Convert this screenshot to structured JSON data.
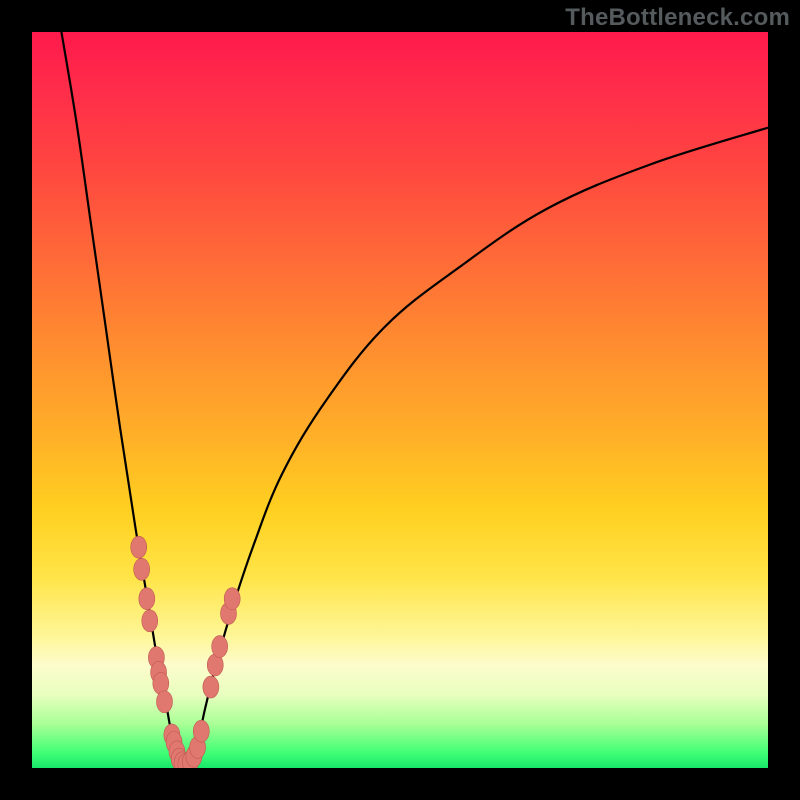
{
  "attribution": "TheBottleneck.com",
  "colors": {
    "frame": "#000000",
    "gradient_stops": [
      "#ff1a4b",
      "#ff2d4a",
      "#ff4540",
      "#ff6838",
      "#ff8b30",
      "#ffb028",
      "#ffd020",
      "#ffe448",
      "#fef696",
      "#fdfccc",
      "#e8ffbf",
      "#a9ff96",
      "#3fff76",
      "#18e66a"
    ],
    "curve": "#000000",
    "markers_fill": "#e0786f",
    "markers_stroke": "#c15a52"
  },
  "chart_data": {
    "type": "line",
    "title": "",
    "xlabel": "",
    "ylabel": "",
    "xlim": [
      0,
      100
    ],
    "ylim": [
      0,
      100
    ],
    "grid": false,
    "legend": false,
    "series": [
      {
        "name": "left-branch",
        "x": [
          4,
          6,
          8,
          10,
          12,
          14,
          15,
          16,
          17,
          18,
          18.7,
          19.3,
          20
        ],
        "y": [
          100,
          88,
          74,
          60,
          46,
          33,
          27,
          21,
          15,
          10,
          6,
          3,
          0
        ]
      },
      {
        "name": "right-branch",
        "x": [
          22,
          22.7,
          23.5,
          25,
          27,
          30,
          34,
          40,
          48,
          58,
          70,
          84,
          100
        ],
        "y": [
          0,
          4,
          8,
          14,
          21,
          30,
          40,
          50,
          60,
          68,
          76,
          82,
          87
        ]
      }
    ],
    "bottom_join": {
      "x": [
        20,
        20.5,
        21,
        21.5,
        22
      ],
      "y": [
        0,
        0,
        0,
        0,
        0
      ]
    },
    "markers": [
      {
        "x": 14.5,
        "y": 30
      },
      {
        "x": 14.9,
        "y": 27
      },
      {
        "x": 15.6,
        "y": 23
      },
      {
        "x": 16.0,
        "y": 20
      },
      {
        "x": 16.9,
        "y": 15
      },
      {
        "x": 17.2,
        "y": 13
      },
      {
        "x": 17.5,
        "y": 11.5
      },
      {
        "x": 18.0,
        "y": 9
      },
      {
        "x": 19.0,
        "y": 4.5
      },
      {
        "x": 19.3,
        "y": 3.5
      },
      {
        "x": 19.7,
        "y": 2.2
      },
      {
        "x": 20.0,
        "y": 1.2
      },
      {
        "x": 20.4,
        "y": 0.7
      },
      {
        "x": 20.9,
        "y": 0.5
      },
      {
        "x": 21.5,
        "y": 0.8
      },
      {
        "x": 22.0,
        "y": 1.6
      },
      {
        "x": 22.5,
        "y": 2.8
      },
      {
        "x": 23.0,
        "y": 5.0
      },
      {
        "x": 24.3,
        "y": 11
      },
      {
        "x": 24.9,
        "y": 14
      },
      {
        "x": 25.5,
        "y": 16.5
      },
      {
        "x": 26.7,
        "y": 21
      },
      {
        "x": 27.2,
        "y": 23
      }
    ]
  }
}
